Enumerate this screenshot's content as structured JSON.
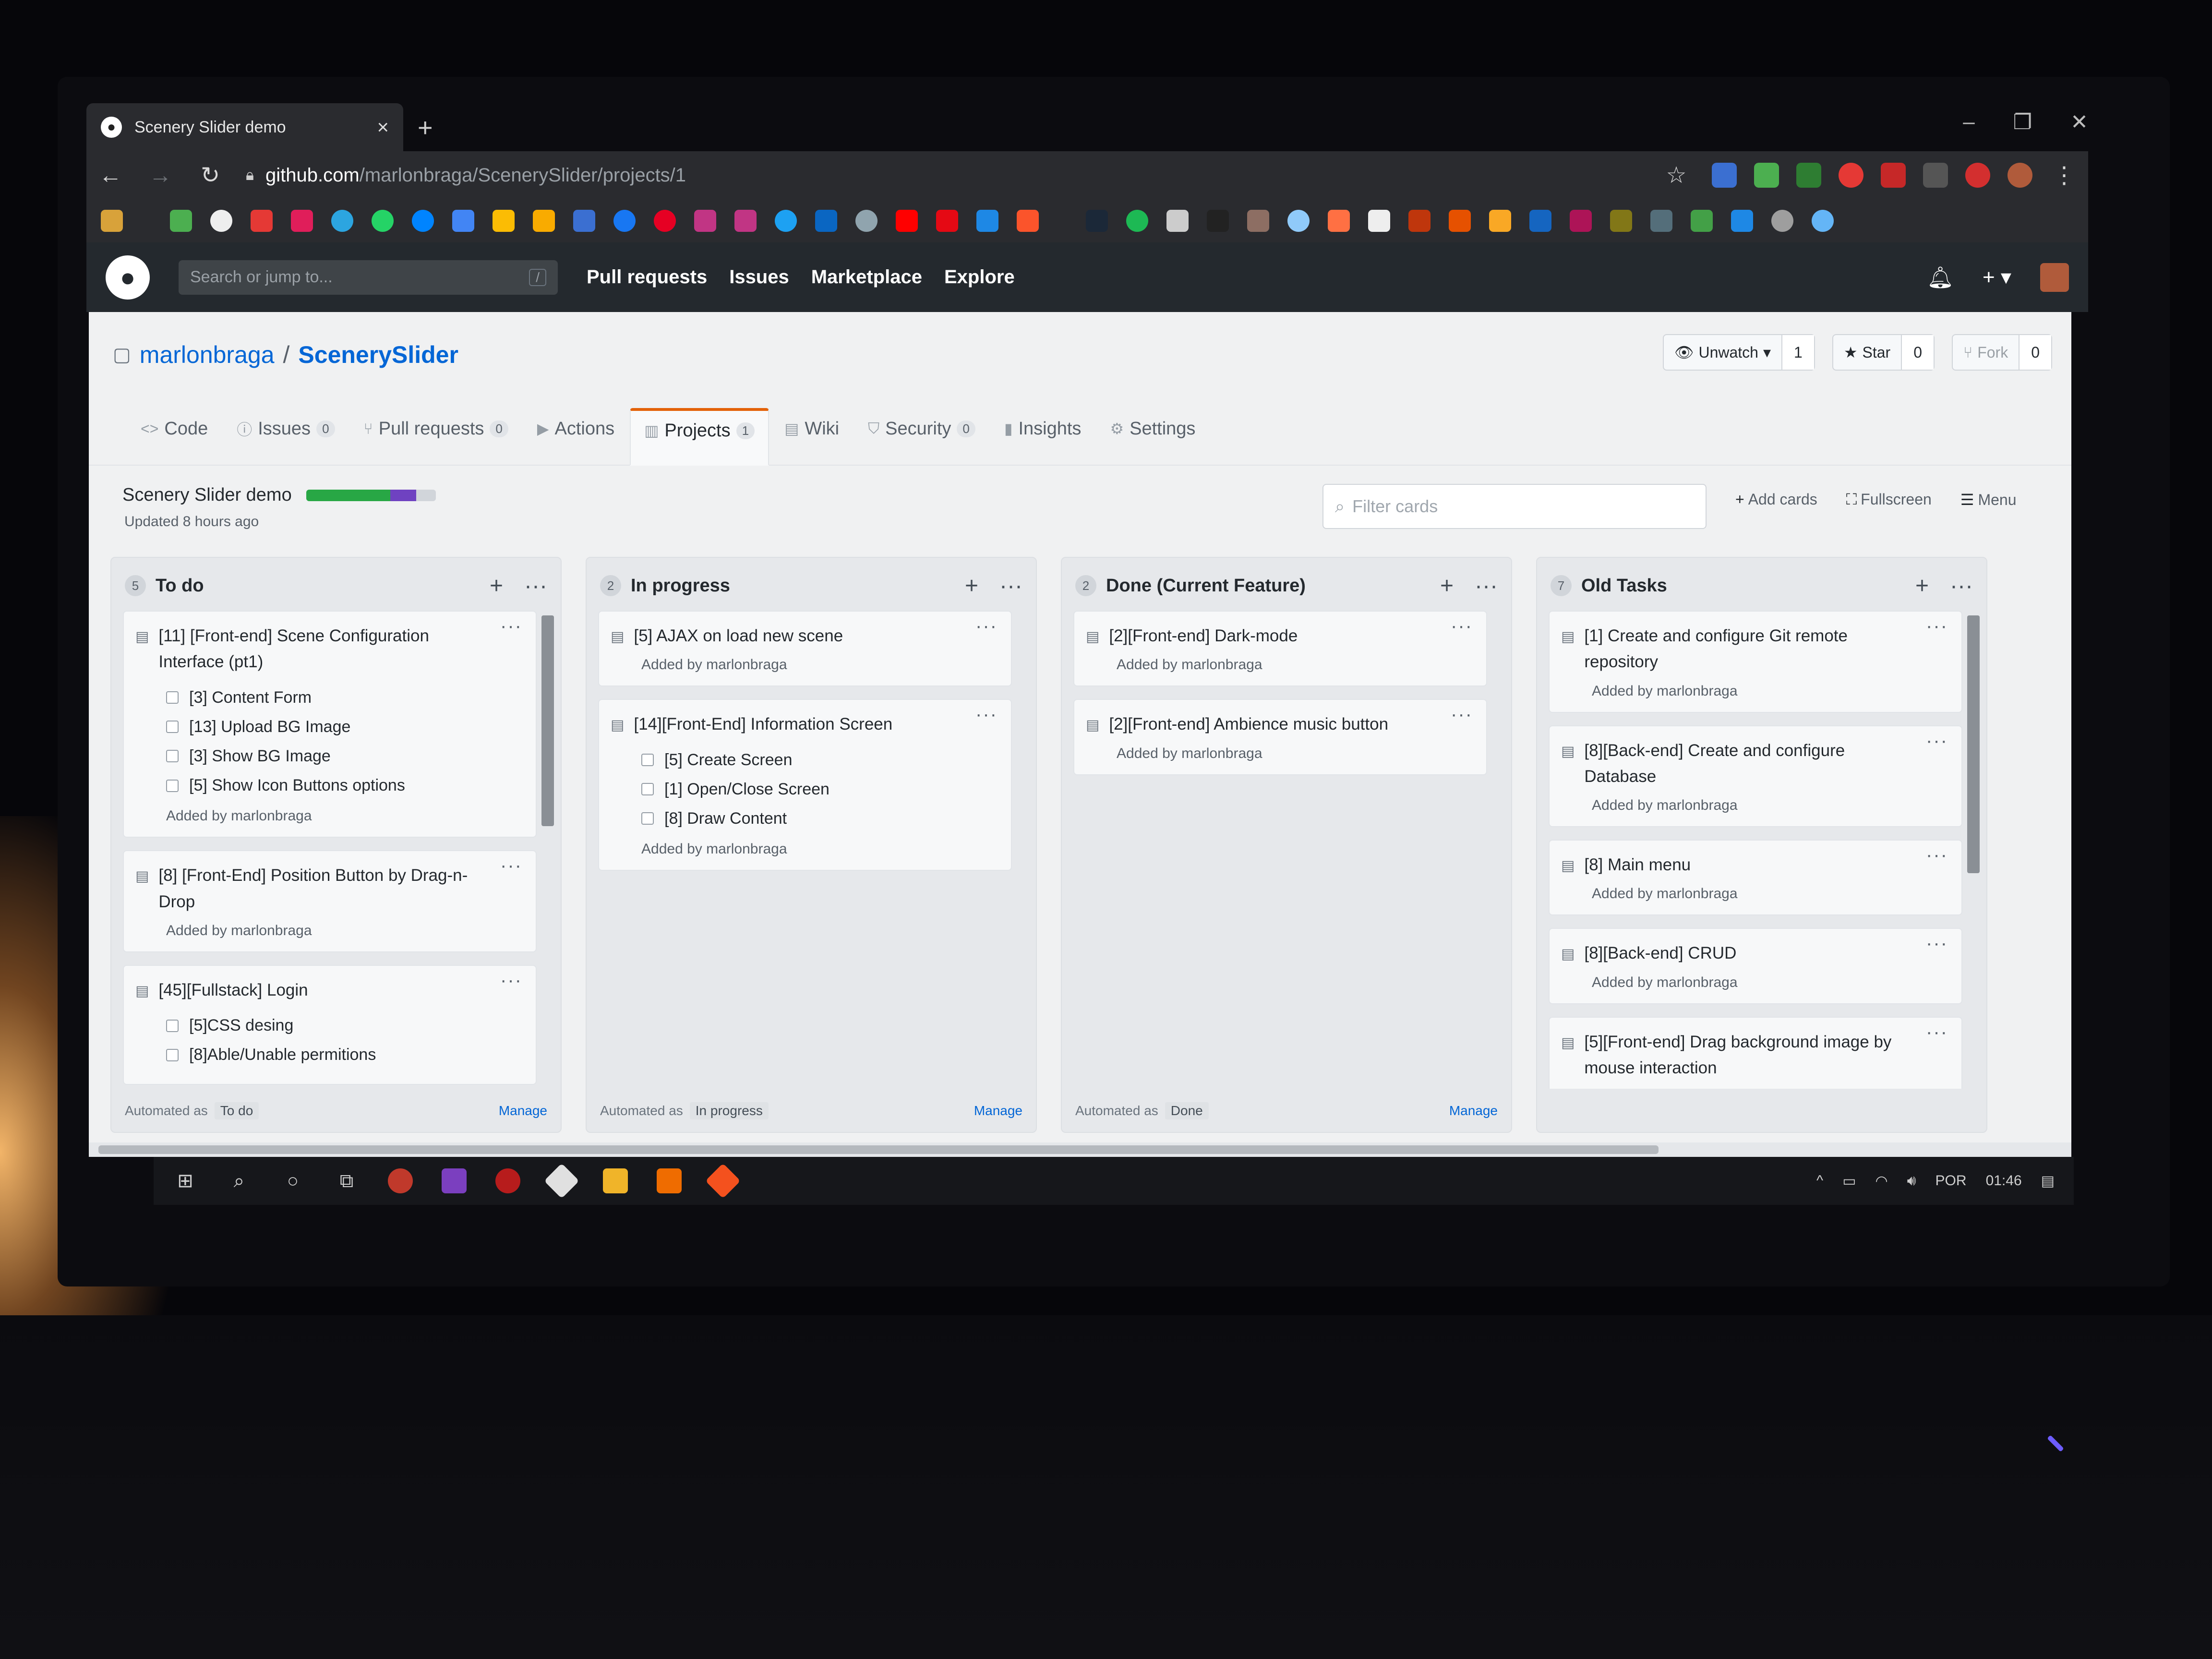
{
  "browser": {
    "tab_title": "Scenery Slider demo",
    "tab_close": "×",
    "new_tab": "+",
    "url_host": "github.com",
    "url_path": "/marlonbraga/ScenerySlider/projects/1"
  },
  "github_header": {
    "search_placeholder": "Search or jump to...",
    "search_shortcut": "/",
    "nav": [
      "Pull requests",
      "Issues",
      "Marketplace",
      "Explore"
    ]
  },
  "repo": {
    "owner": "marlonbraga",
    "separator": "/",
    "name": "ScenerySlider",
    "unwatch_label": "Unwatch",
    "unwatch_count": "1",
    "star_label": "Star",
    "star_count": "0",
    "fork_label": "Fork",
    "fork_count": "0"
  },
  "repo_nav": [
    {
      "label": "Code",
      "icon": "code-icon",
      "glyph": "<>"
    },
    {
      "label": "Issues",
      "count": "0",
      "icon": "issue-icon",
      "glyph": "ⓘ"
    },
    {
      "label": "Pull requests",
      "count": "0",
      "icon": "pull-request-icon",
      "glyph": "⑂"
    },
    {
      "label": "Actions",
      "icon": "play-icon",
      "glyph": "▶"
    },
    {
      "label": "Projects",
      "count": "1",
      "icon": "project-icon",
      "glyph": "▥",
      "active": true
    },
    {
      "label": "Wiki",
      "icon": "book-icon",
      "glyph": "▤"
    },
    {
      "label": "Security",
      "count": "0",
      "icon": "shield-icon",
      "glyph": "⛉"
    },
    {
      "label": "Insights",
      "icon": "graph-icon",
      "glyph": "▮"
    },
    {
      "label": "Settings",
      "icon": "gear-icon",
      "glyph": "⚙"
    }
  ],
  "project": {
    "title": "Scenery Slider demo",
    "updated": "Updated 8 hours ago",
    "progress": {
      "done_pct": 0.65,
      "in_progress_pct": 0.2
    },
    "filter_placeholder": "Filter cards",
    "add_cards": "Add cards",
    "fullscreen": "Fullscreen",
    "menu": "Menu"
  },
  "columns": [
    {
      "count": "5",
      "name": "To do",
      "automated_prefix": "Automated as",
      "automated_tag": "To do",
      "manage": "Manage",
      "cards": [
        {
          "title": "[11] [Front-end] Scene Configuration Interface (pt1)",
          "tasks": [
            "[3] Content Form",
            "[13] Upload BG Image",
            "[3] Show BG Image",
            "[5] Show Icon Buttons options"
          ],
          "added": "Added by marlonbraga"
        },
        {
          "title": "[8] [Front-End] Position Button by Drag-n-Drop",
          "tasks": [],
          "added": "Added by marlonbraga"
        },
        {
          "title": "[45][Fullstack] Login",
          "tasks": [
            "[5]CSS desing",
            "[8]Able/Unable permitions"
          ],
          "added": ""
        }
      ]
    },
    {
      "count": "2",
      "name": "In progress",
      "automated_prefix": "Automated as",
      "automated_tag": "In progress",
      "manage": "Manage",
      "cards": [
        {
          "title": "[5] AJAX on load new scene",
          "tasks": [],
          "added": "Added by marlonbraga"
        },
        {
          "title": "[14][Front-End] Information Screen",
          "tasks": [
            "[5] Create Screen",
            "[1] Open/Close Screen",
            "[8] Draw Content"
          ],
          "added": "Added by marlonbraga"
        }
      ]
    },
    {
      "count": "2",
      "name": "Done (Current Feature)",
      "automated_prefix": "Automated as",
      "automated_tag": "Done",
      "manage": "Manage",
      "cards": [
        {
          "title": "[2][Front-end] Dark-mode",
          "tasks": [],
          "added": "Added by marlonbraga"
        },
        {
          "title": "[2][Front-end] Ambience music button",
          "tasks": [],
          "added": "Added by marlonbraga"
        }
      ]
    },
    {
      "count": "7",
      "name": "Old Tasks",
      "automated_prefix": "",
      "automated_tag": "",
      "manage": "",
      "cards": [
        {
          "title": "[1] Create and configure Git remote repository",
          "tasks": [],
          "added": "Added by marlonbraga"
        },
        {
          "title": "[8][Back-end] Create and configure Database",
          "tasks": [],
          "added": "Added by marlonbraga"
        },
        {
          "title": "[8] Main menu",
          "tasks": [],
          "added": "Added by marlonbraga"
        },
        {
          "title": "[8][Back-end] CRUD",
          "tasks": [],
          "added": "Added by marlonbraga"
        },
        {
          "title": "[5][Front-end] Drag background image by mouse interaction",
          "tasks": [],
          "added": ""
        }
      ]
    }
  ],
  "taskbar": {
    "language": "POR",
    "time": "01:46"
  },
  "colors": {
    "github_header": "#24292e",
    "link": "#0366d6",
    "active_tab_accent": "#e36209",
    "progress_done": "#28a745",
    "progress_in_progress": "#6f42c1"
  }
}
